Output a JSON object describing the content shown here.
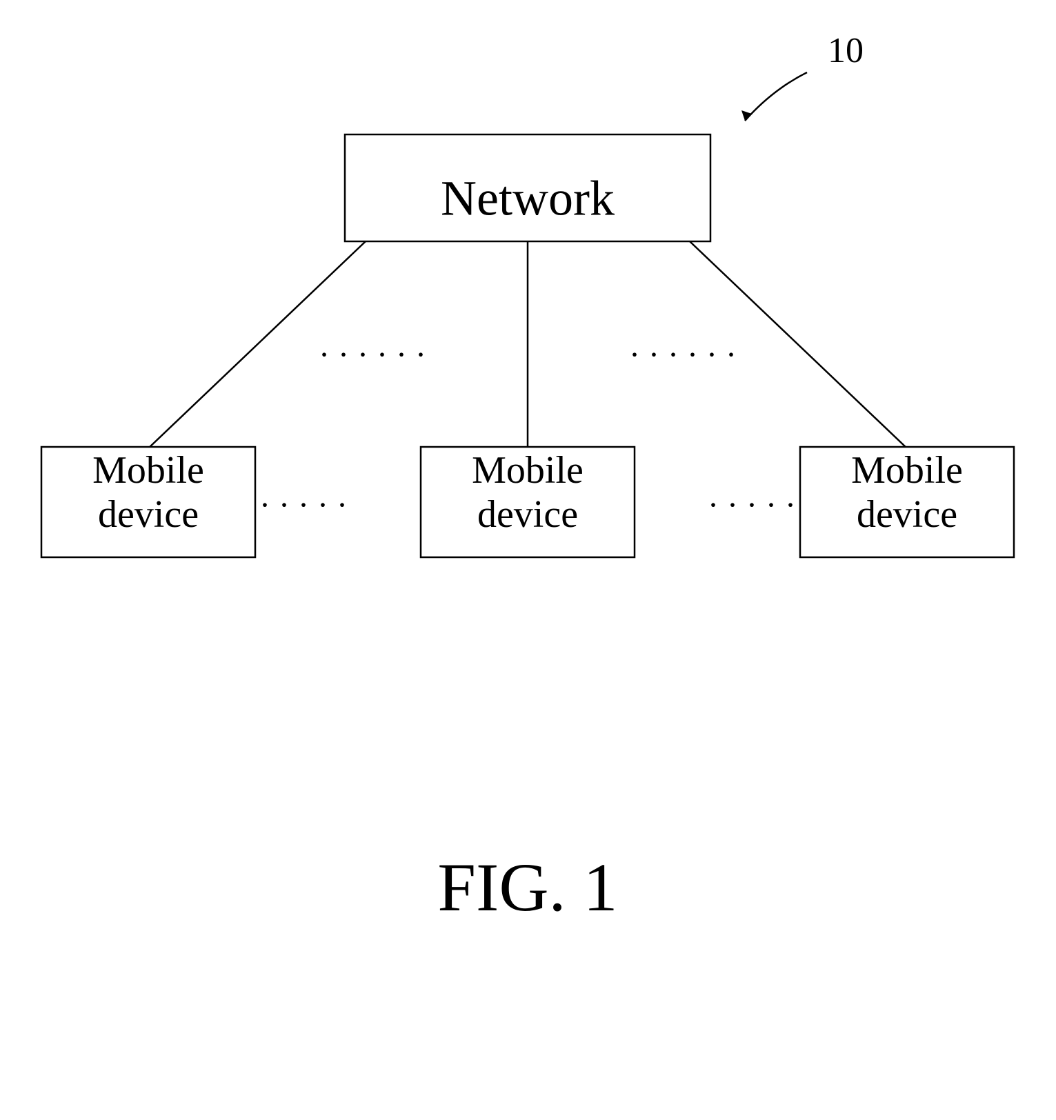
{
  "diagram": {
    "title": "FIG. 1",
    "reference_number": "10",
    "network_label": "Network",
    "mobile_device_label_1": "Mobile\ndevice",
    "mobile_device_label_2": "Mobile\ndevice",
    "mobile_device_label_3": "Mobile\ndevice",
    "dots_ellipsis": "· · · · · ·"
  },
  "colors": {
    "background": "#ffffff",
    "foreground": "#000000",
    "box_stroke": "#000000"
  }
}
